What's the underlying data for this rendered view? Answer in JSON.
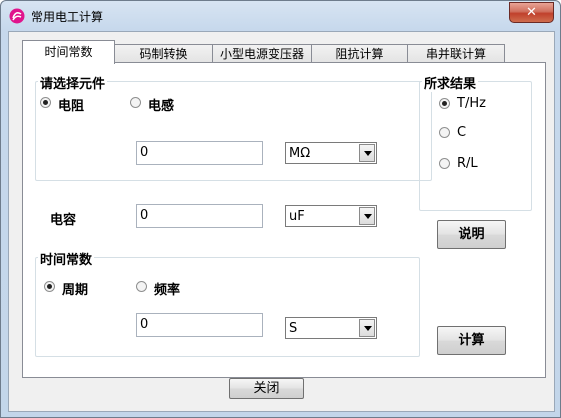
{
  "window": {
    "title": "常用电工计算",
    "close_label": "✕"
  },
  "tabs": [
    {
      "label": "时间常数",
      "active": true
    },
    {
      "label": "码制转换",
      "active": false
    },
    {
      "label": "小型电源变压器",
      "active": false
    },
    {
      "label": "阻抗计算",
      "active": false
    },
    {
      "label": "串并联计算",
      "active": false
    }
  ],
  "component_group": {
    "title": "请选择元件",
    "options": [
      {
        "label": "电阻",
        "selected": true
      },
      {
        "label": "电感",
        "selected": false
      }
    ],
    "value": "0",
    "unit": "MΩ"
  },
  "result_group": {
    "title": "所求结果",
    "options": [
      {
        "label": "T/Hz",
        "selected": true
      },
      {
        "label": "C",
        "selected": false
      },
      {
        "label": "R/L",
        "selected": false
      }
    ]
  },
  "capacitor": {
    "label": "电容",
    "value": "0",
    "unit": "uF"
  },
  "time_group": {
    "title": "时间常数",
    "options": [
      {
        "label": "周期",
        "selected": true
      },
      {
        "label": "频率",
        "selected": false
      }
    ],
    "value": "0",
    "unit": "S"
  },
  "buttons": {
    "explain": "说明",
    "calculate": "计算",
    "close": "关闭"
  }
}
